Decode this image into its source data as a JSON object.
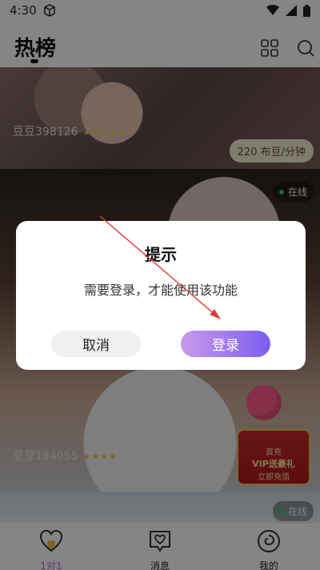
{
  "status_bar": {
    "time": "4:30"
  },
  "header": {
    "title": "热榜"
  },
  "feed": {
    "cards": [
      {
        "name": "豆豆398126",
        "stars": "★★★★★",
        "price": "220 布豆/分钟"
      },
      {
        "name": "豆豆184055",
        "stars": "★★★★",
        "online_label": "在线",
        "promo": {
          "line1": "首充",
          "line2": "VIP送豪礼",
          "line3": "立即充值"
        }
      },
      {
        "online_label": "在线"
      }
    ]
  },
  "dialog": {
    "title": "提示",
    "message": "需要登录，才能使用该功能",
    "cancel_label": "取消",
    "login_label": "登录"
  },
  "tabbar": {
    "items": [
      {
        "label": "1对1",
        "icon": "heart-chat-icon",
        "active": true
      },
      {
        "label": "消息",
        "icon": "message-heart-icon",
        "active": false
      },
      {
        "label": "我的",
        "icon": "profile-spiral-icon",
        "active": false
      }
    ]
  },
  "colors": {
    "accent_gradient_start": "#c79bea",
    "accent_gradient_end": "#7c5df0",
    "active_tab": "#b96ad9",
    "annotation_arrow": "#e03b3b"
  }
}
